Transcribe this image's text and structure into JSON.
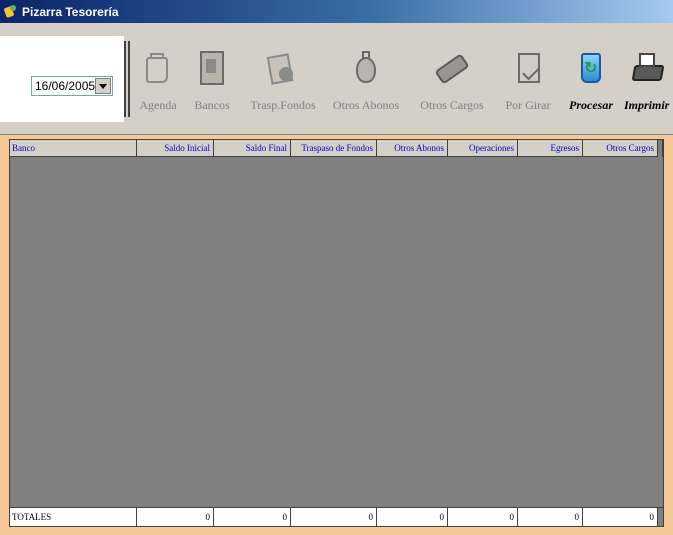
{
  "window": {
    "title": "Pizarra Tesorería",
    "icon": "app-icon"
  },
  "toolbar": {
    "date_value": "16/06/2005",
    "buttons": [
      {
        "label": "Agenda",
        "icon": "agenda-icon",
        "enabled": false
      },
      {
        "label": "Bancos",
        "icon": "safe-icon",
        "enabled": false
      },
      {
        "label": "Trasp.Fondos",
        "icon": "transfer-icon",
        "enabled": false
      },
      {
        "label": "Otros Abonos",
        "icon": "money-bag-icon",
        "enabled": false
      },
      {
        "label": "Otros Cargos",
        "icon": "card-icon",
        "enabled": false
      },
      {
        "label": "Por Girar",
        "icon": "check-doc-icon",
        "enabled": false
      },
      {
        "label": "Procesar",
        "icon": "recycle-bin-icon",
        "enabled": true
      },
      {
        "label": "Imprimir",
        "icon": "printer-icon",
        "enabled": true
      }
    ]
  },
  "grid": {
    "columns": [
      "Banco",
      "Saldo Inicial",
      "Saldo Final",
      "Traspaso de Fondos",
      "Otros Abonos",
      "Operaciones",
      "Egresos",
      "Otros Cargos"
    ],
    "totals": [
      "TOTALES",
      "0",
      "0",
      "0",
      "0",
      "0",
      "0",
      "0"
    ]
  },
  "colors": {
    "header_text": "#0000cc",
    "grid_background": "#808080",
    "frame_background": "#f6c896",
    "toolbar_background": "#d4d0c8"
  }
}
